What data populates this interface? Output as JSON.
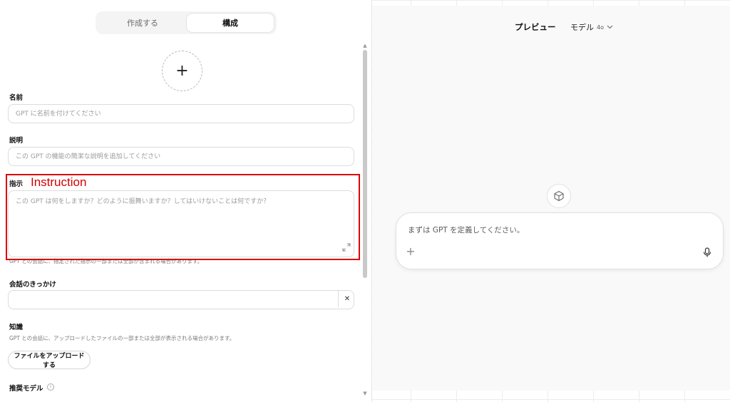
{
  "tabs": {
    "create": "作成する",
    "configure": "構成"
  },
  "avatar": {
    "glyph": "+"
  },
  "name": {
    "label": "名前",
    "placeholder": "GPT に名前を付けてください"
  },
  "description": {
    "label": "説明",
    "placeholder": "この GPT の機能の簡潔な説明を追加してください"
  },
  "instructions": {
    "label": "指示",
    "placeholder": "この GPT は何をしますか？どのように振舞いますか？してはいけないことは何ですか？",
    "hint": "GPT との会話に、指定された指示の一部または全部が含まれる場合があります。"
  },
  "annotation": {
    "text": "Instruction",
    "color": "#e00000"
  },
  "conversation_starters": {
    "label": "会話のきっかけ",
    "value": "",
    "clear_glyph": "✕"
  },
  "knowledge": {
    "label": "知識",
    "hint": "GPT との会話に、アップロードしたファイルの一部または全部が表示される場合があります。",
    "upload_label": "ファイルをアップロードする"
  },
  "recommended_model": {
    "label": "推奨モデル",
    "info_glyph": "!"
  },
  "preview": {
    "title": "プレビュー",
    "model_label": "モデル",
    "model_version": "4o",
    "composer_placeholder": "まずは GPT を定義してください。",
    "plus_glyph": "+"
  }
}
